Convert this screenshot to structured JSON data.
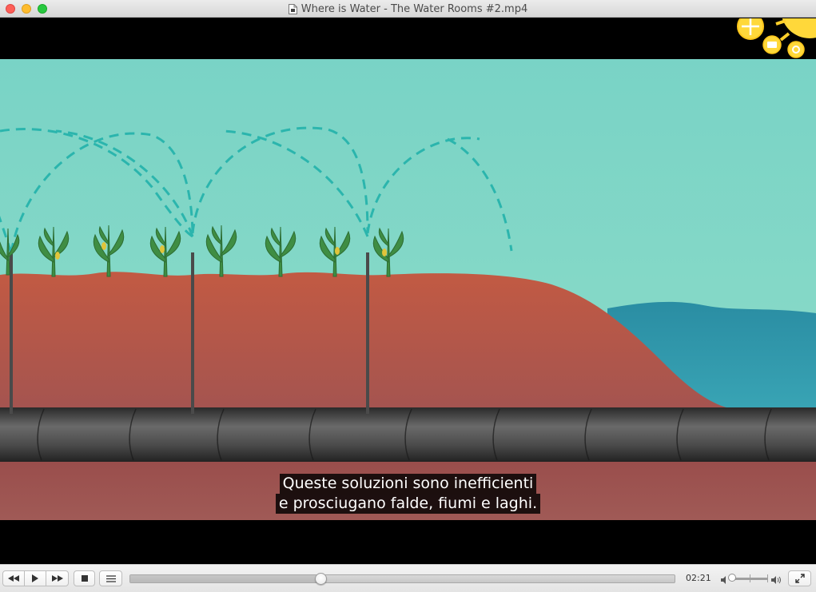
{
  "window": {
    "title": "Where is Water - The Water Rooms #2.mp4",
    "file_icon": "document-icon"
  },
  "video": {
    "subtitle_lines": [
      "Queste soluzioni sono inefficienti",
      "e prosciugano falde, fiumi e laghi."
    ],
    "overlay_icons": [
      "sun-icon",
      "folder-icon",
      "gear-icon"
    ]
  },
  "controls": {
    "buttons": [
      "rewind",
      "play",
      "fast-forward",
      "stop",
      "playlist",
      "fullscreen"
    ],
    "elapsed_time": "02:21",
    "seek_progress": 0.35,
    "volume_level": 0.02
  },
  "colors": {
    "sky": "#7fd6c5",
    "soil": "#b9574a",
    "pipe": "#3a3a3a",
    "water": "#2a92a4",
    "spray": "#2bb5ad"
  }
}
